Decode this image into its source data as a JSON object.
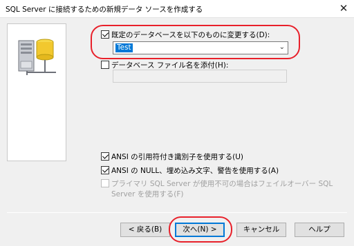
{
  "window": {
    "title": "SQL Server に接続するための新規データ ソースを作成する",
    "close_glyph": "✕"
  },
  "options": {
    "change_default_db": {
      "label": "既定のデータベースを以下のものに変更する(D):",
      "checked": true
    },
    "default_db_value": "Test",
    "attach_db_file": {
      "label": "データベース ファイル名を添付(H):",
      "checked": false,
      "value": ""
    },
    "ansi_quoted": {
      "label": "ANSI の引用符付き識別子を使用する(U)",
      "checked": true
    },
    "ansi_nulls": {
      "label": "ANSI の NULL、埋め込み文字、警告を使用する(A)",
      "checked": true
    },
    "failover": {
      "line1": "プライマリ SQL Server が使用不可の場合はフェイルオーバー SQL",
      "line2": "Server を使用する(F)",
      "checked": false,
      "disabled": true
    }
  },
  "buttons": {
    "back": "< 戻る(B)",
    "next": "次へ(N) >",
    "cancel": "キャンセル",
    "help": "ヘルプ"
  },
  "colors": {
    "accent": "#0078d7",
    "highlight_oval": "#e8202a",
    "dialog_bg": "#f0f0f0"
  },
  "icons": [
    "server-database-icon",
    "chevron-down-icon",
    "close-icon"
  ]
}
